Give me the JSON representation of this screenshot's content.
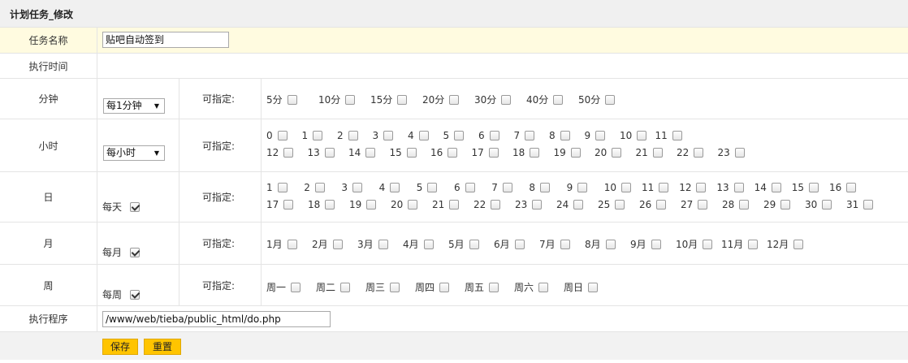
{
  "title": "计划任务_修改",
  "labels": {
    "task_name": "任务名称",
    "exec_time": "执行时间",
    "minute": "分钟",
    "hour": "小时",
    "day": "日",
    "month": "月",
    "week": "周",
    "program": "执行程序"
  },
  "task_name_value": "贴吧自动签到",
  "minute_select": "每1分钟",
  "hour_select": "每小时",
  "every_day": "每天",
  "every_month": "每月",
  "every_week": "每周",
  "specify": "可指定:",
  "minute_options": [
    "5分",
    "10分",
    "15分",
    "20分",
    "30分",
    "40分",
    "50分"
  ],
  "hour_options_row1": [
    "0",
    "1",
    "2",
    "3",
    "4",
    "5",
    "6",
    "7",
    "8",
    "9",
    "10",
    "11"
  ],
  "hour_options_row2": [
    "12",
    "13",
    "14",
    "15",
    "16",
    "17",
    "18",
    "19",
    "20",
    "21",
    "22",
    "23"
  ],
  "day_options_row1": [
    "1",
    "2",
    "3",
    "4",
    "5",
    "6",
    "7",
    "8",
    "9",
    "10",
    "11",
    "12",
    "13",
    "14",
    "15",
    "16"
  ],
  "day_options_row2": [
    "17",
    "18",
    "19",
    "20",
    "21",
    "22",
    "23",
    "24",
    "25",
    "26",
    "27",
    "28",
    "29",
    "30",
    "31"
  ],
  "month_options": [
    "1月",
    "2月",
    "3月",
    "4月",
    "5月",
    "6月",
    "7月",
    "8月",
    "9月",
    "10月",
    "11月",
    "12月"
  ],
  "week_options": [
    "周一",
    "周二",
    "周三",
    "周四",
    "周五",
    "周六",
    "周日"
  ],
  "program_value": "/www/web/tieba/public_html/do.php",
  "buttons": {
    "save": "保存",
    "reset": "重置"
  }
}
